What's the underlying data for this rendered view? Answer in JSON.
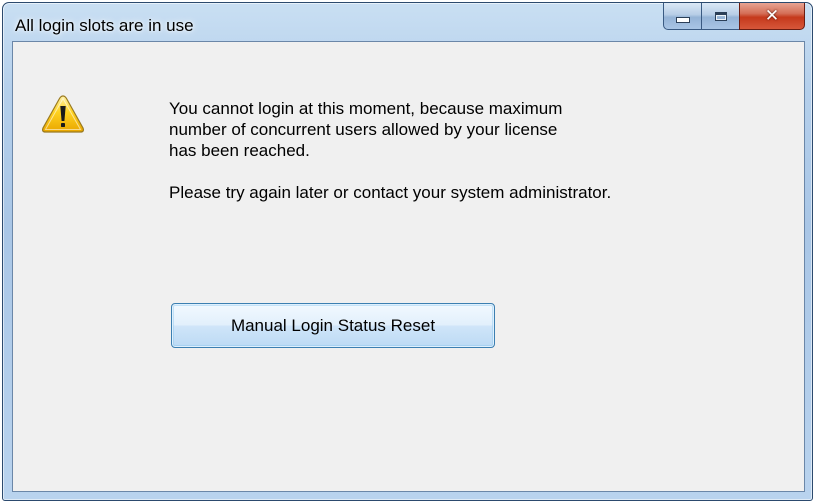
{
  "window": {
    "title": "All login slots are in use"
  },
  "caption_buttons": {
    "minimize_icon": "minimize-icon",
    "maximize_icon": "maximize-icon",
    "close_glyph": "✕"
  },
  "dialog": {
    "icon": "warning-icon",
    "message_lines": [
      "You cannot login at this moment, because maximum",
      "number of concurrent users allowed by your license",
      "has been reached."
    ],
    "message_secondary": "Please try again later or contact your system administrator.",
    "reset_button_label": "Manual Login Status Reset"
  },
  "colors": {
    "client_background": "#f0f0f0",
    "frame_blue": "#b4cfeb",
    "close_red": "#c5391c",
    "warning_yellow": "#ffd21f"
  }
}
